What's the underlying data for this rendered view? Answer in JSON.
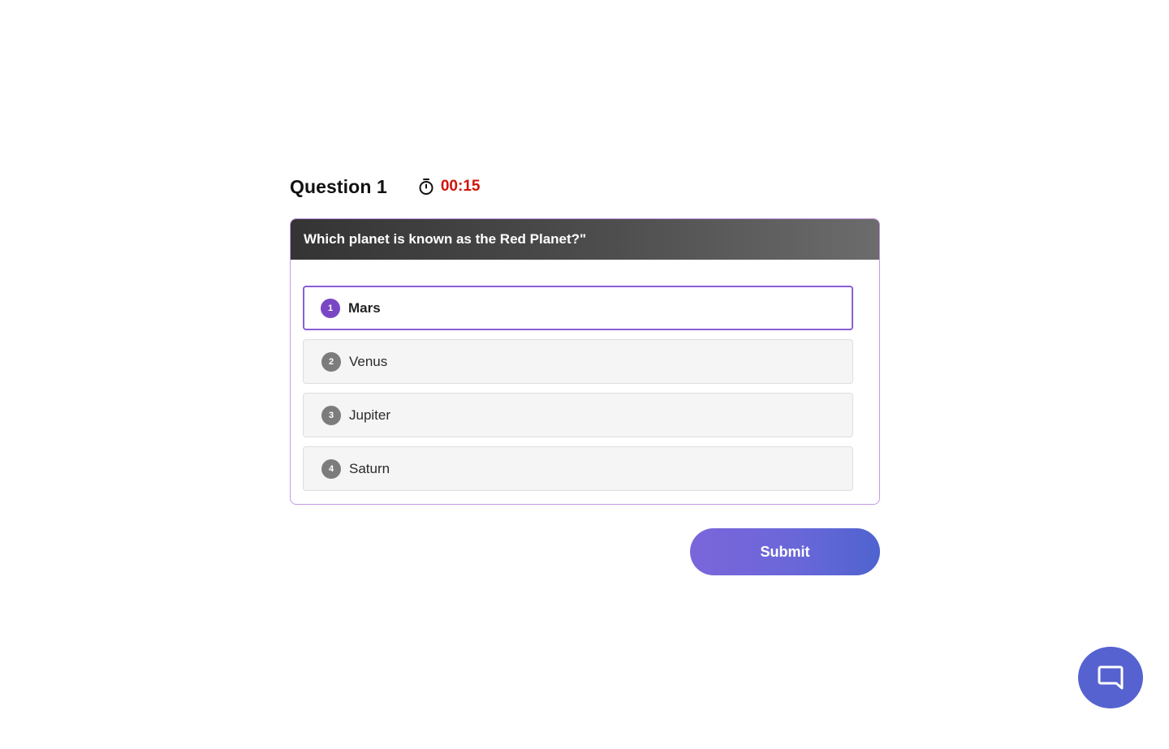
{
  "quiz": {
    "question_label": "Question 1",
    "timer": {
      "icon": "stopwatch-icon",
      "value": "00:15",
      "color": "#d0140b"
    },
    "question_text": "Which planet is known as the Red Planet?\"",
    "options": [
      {
        "number": "1",
        "label": "Mars",
        "selected": true
      },
      {
        "number": "2",
        "label": "Venus",
        "selected": false
      },
      {
        "number": "3",
        "label": "Jupiter",
        "selected": false
      },
      {
        "number": "4",
        "label": "Saturn",
        "selected": false
      }
    ],
    "submit_label": "Submit"
  },
  "chat": {
    "icon": "chat-bubble-icon"
  },
  "colors": {
    "accent": "#7a47c4",
    "selected_border": "#8a5fd6",
    "submit_gradient_start": "#7b66db",
    "submit_gradient_end": "#4f63cf",
    "chat_button": "#5662cf"
  }
}
